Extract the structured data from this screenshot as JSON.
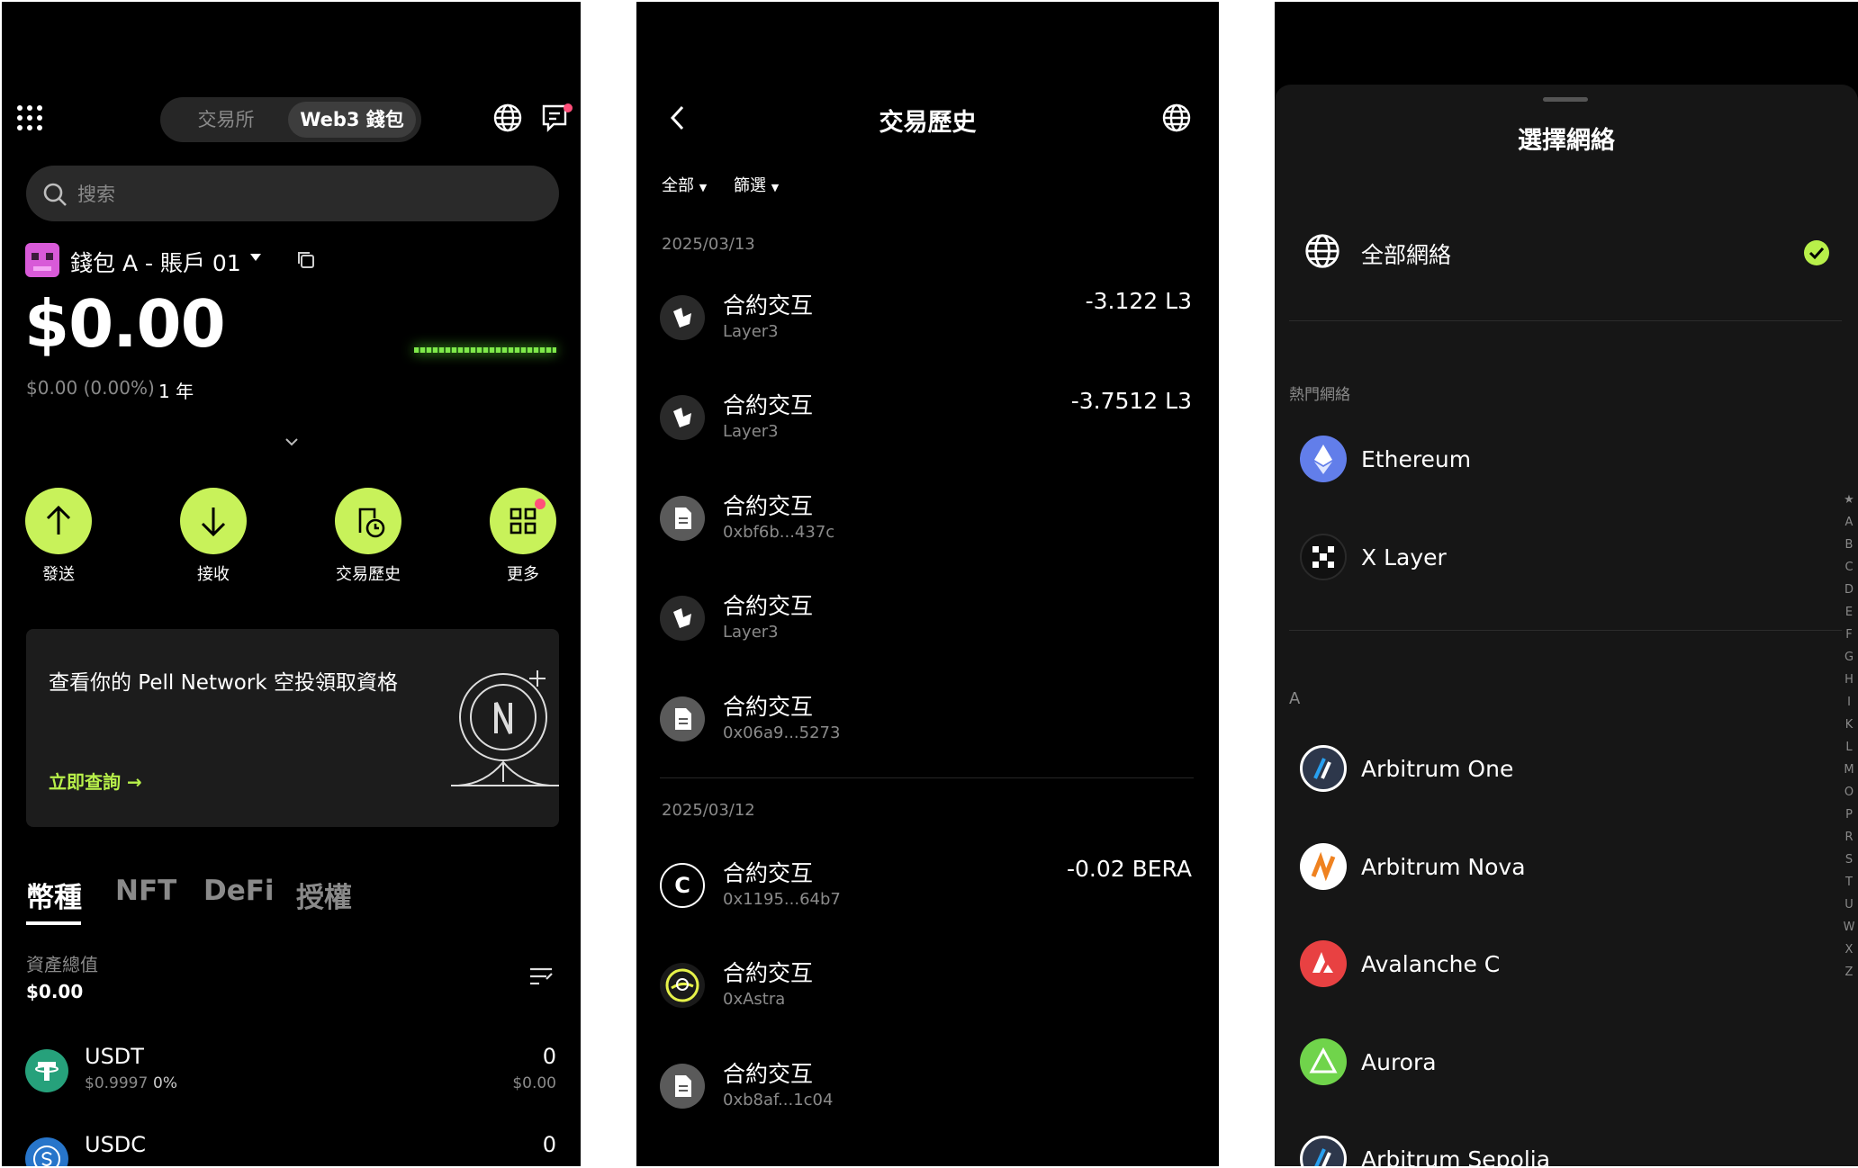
{
  "wallet_home": {
    "segment": {
      "exchange": "交易所",
      "web3": "Web3 錢包"
    },
    "search": {
      "placeholder": "搜索"
    },
    "account": {
      "name": "錢包 A - 賬戶 01"
    },
    "balance": {
      "amount": "$0.00",
      "change": "$0.00 (0.00%)",
      "period": "1 年"
    },
    "actions": [
      {
        "label": "發送"
      },
      {
        "label": "接收"
      },
      {
        "label": "交易歷史"
      },
      {
        "label": "更多"
      }
    ],
    "promo": {
      "text": "查看你的 Pell Network 空投領取資格",
      "link": "立即查詢 →"
    },
    "tabs": [
      "幣種",
      "NFT",
      "DeFi",
      "授權"
    ],
    "total": {
      "label": "資產總值",
      "value": "$0.00"
    },
    "assets": [
      {
        "symbol": "USDT",
        "price": "$0.9997",
        "change": "0%",
        "amount": "0",
        "value": "$0.00"
      },
      {
        "symbol": "USDC",
        "amount": "0"
      }
    ]
  },
  "tx_history": {
    "title": "交易歷史",
    "filters": {
      "all": "全部",
      "filter": "篩選"
    },
    "groups": [
      {
        "date": "2025/03/13",
        "items": [
          {
            "title": "合約交互",
            "sub": "Layer3",
            "amount": "-3.122 L3",
            "icon": "layer3-icon"
          },
          {
            "title": "合約交互",
            "sub": "Layer3",
            "amount": "-3.7512 L3",
            "icon": "layer3-icon"
          },
          {
            "title": "合約交互",
            "sub": "0xbf6b...437c",
            "amount": "",
            "icon": "document-icon"
          },
          {
            "title": "合約交互",
            "sub": "Layer3",
            "amount": "",
            "icon": "layer3-icon"
          },
          {
            "title": "合約交互",
            "sub": "0x06a9...5273",
            "amount": "",
            "icon": "document-icon"
          }
        ]
      },
      {
        "date": "2025/03/12",
        "items": [
          {
            "title": "合約交互",
            "sub": "0x1195...64b7",
            "amount": "-0.02 BERA",
            "icon": "c-coin-icon"
          },
          {
            "title": "合約交互",
            "sub": "0xAstra",
            "amount": "",
            "icon": "astra-icon"
          },
          {
            "title": "合約交互",
            "sub": "0xb8af...1c04",
            "amount": "",
            "icon": "document-icon"
          }
        ]
      }
    ]
  },
  "network_select": {
    "title": "選擇網絡",
    "all_networks": "全部網絡",
    "popular_label": "熱門網絡",
    "popular": [
      {
        "name": "Ethereum",
        "color": "#627eea"
      },
      {
        "name": "X Layer",
        "color": "#111111"
      }
    ],
    "section_a": "A",
    "a_networks": [
      {
        "name": "Arbitrum One",
        "color": "#2d374b"
      },
      {
        "name": "Arbitrum Nova",
        "color": "#ef8220"
      },
      {
        "name": "Avalanche C",
        "color": "#e84142"
      },
      {
        "name": "Aurora",
        "color": "#70d44b"
      },
      {
        "name": "Arbitrum Sepolia",
        "color": "#2d374b"
      }
    ],
    "index": [
      "★",
      "A",
      "B",
      "C",
      "D",
      "E",
      "F",
      "G",
      "H",
      "I",
      "K",
      "L",
      "M",
      "O",
      "P",
      "R",
      "S",
      "T",
      "U",
      "W",
      "X",
      "Z"
    ]
  }
}
